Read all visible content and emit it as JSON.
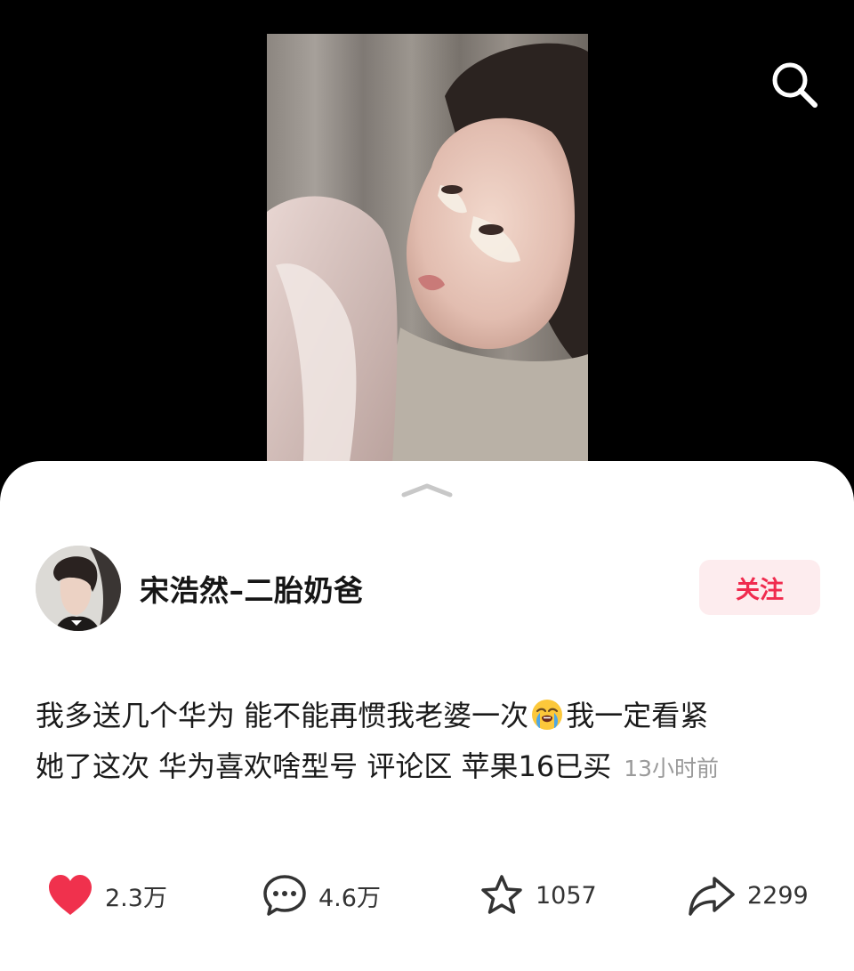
{
  "media": {
    "image": "portrait-photo-woman-with-eye-patches"
  },
  "header": {
    "search_icon": "search-icon"
  },
  "sheet": {
    "handle_icon": "chevron-up-icon"
  },
  "author": {
    "name": "宋浩然–二胎奶爸",
    "avatar": "avatar-photo",
    "follow_label": "关注"
  },
  "post": {
    "line1_a": "我多送几个华为 能不能再惯我老婆一次",
    "emoji": "loudly-crying-face-emoji",
    "line1_b": "我一定看紧",
    "line2": "她了这次 华为喜欢啥型号 评论区 苹果16已买",
    "time": "13小时前"
  },
  "actions": {
    "like": {
      "icon": "heart-icon",
      "count": "2.3万"
    },
    "comment": {
      "icon": "comment-icon",
      "count": "4.6万"
    },
    "favorite": {
      "icon": "star-icon",
      "count": "1057"
    },
    "share": {
      "icon": "share-icon",
      "count": "2299"
    }
  },
  "colors": {
    "accent": "#f02b4e",
    "follow_bg": "#fdecee",
    "like": "#f0314d"
  }
}
